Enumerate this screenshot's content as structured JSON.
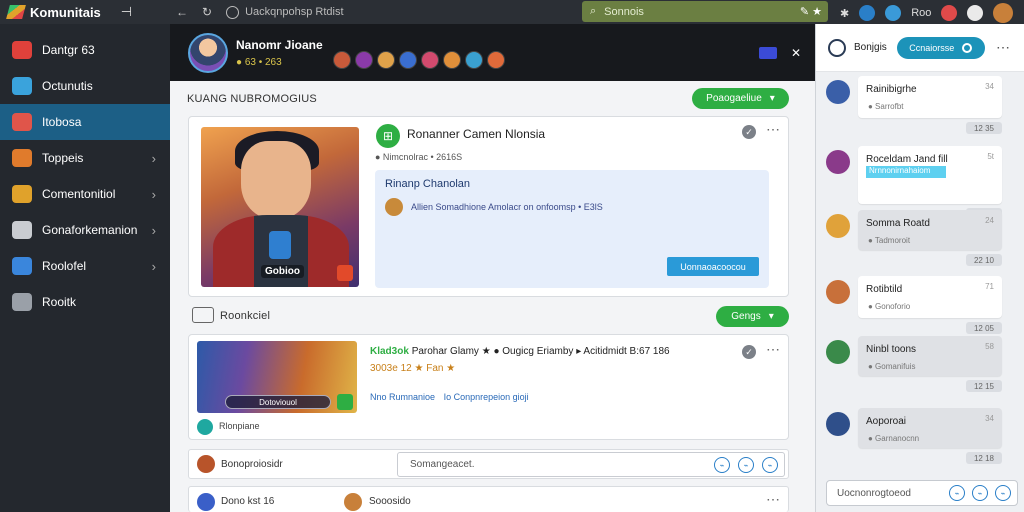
{
  "browser": {
    "app_title": "Komunitais",
    "pin_icon": "pin-icon",
    "url": "Uackqnpohsp Rtdist",
    "search_text": "Sonnois",
    "toolbar_text": "Roo"
  },
  "sidebar": {
    "items": [
      {
        "label": "Dantgr 63",
        "icon": "dashboard-icon",
        "color": "#e0413b",
        "chevron": false,
        "active": false
      },
      {
        "label": "Octunutis",
        "icon": "puzzle-icon",
        "color": "#3aa3dc",
        "chevron": false,
        "active": false
      },
      {
        "label": "Itobosa",
        "icon": "cube-icon",
        "color": "#e0554a",
        "chevron": false,
        "active": true
      },
      {
        "label": "Toppeis",
        "icon": "group-icon",
        "color": "#e07b2c",
        "chevron": true,
        "active": false
      },
      {
        "label": "Comentonitiol",
        "icon": "book-icon",
        "color": "#e0a22b",
        "chevron": true,
        "active": false
      },
      {
        "label": "Gonaforkemanion",
        "icon": "shield-icon",
        "color": "#c9ccd1",
        "chevron": true,
        "active": false
      },
      {
        "label": "Roolofel",
        "icon": "apps-icon",
        "color": "#3a86dc",
        "chevron": true,
        "active": false
      },
      {
        "label": "Rooitk",
        "icon": "calendar-icon",
        "color": "#9aa0a8",
        "chevron": false,
        "active": false
      }
    ]
  },
  "header": {
    "name": "Nanomr Jioane",
    "sub": "● 63 • 263",
    "member_colors": [
      "#c85a3a",
      "#8a3aa8",
      "#e0a24a",
      "#3a6ed0",
      "#d24a6e",
      "#e08f3a",
      "#3aa0d0",
      "#e06a3a"
    ]
  },
  "section1": {
    "title": "KUANG NUBROMOGIUS",
    "button": "Poaogaeliue"
  },
  "post1": {
    "character_tag": "Gobioo",
    "title": "Ronanner Camen Nlonsia",
    "meta": "● Nimcnolrac • 2616S",
    "info_title": "Rinanp Chanolan",
    "info_text": "Allien Somadhione Amolacr on onfoomsp • E3lS",
    "link_button": "Uonnaoacoocou",
    "icon_label": "✓"
  },
  "section2": {
    "title": "Roonkciel",
    "button": "Gengs"
  },
  "post2": {
    "image_bar": "Dotoviouol",
    "headline_prefix": "Klad3ok",
    "headline": "Parohar Glamy ★ ● Ougicg Eriamby ▸ Acitidmidt B:67 186",
    "subline": "3003e 12 ★ Fan ★",
    "tag1": "Nno Rumnanioe",
    "tag2": "Io Conpnrepeion gioji",
    "footer": "Rlonpiane"
  },
  "comment_row": {
    "author": "Bonoproiosidr",
    "placeholder": "Somangeacet."
  },
  "bottom_row": {
    "author": "Dono kst 16",
    "second": "Sooosido"
  },
  "chat": {
    "title": "Bonjgis",
    "pill": "Ccnaiorsse",
    "messages": [
      {
        "name": "Rainibigrhe",
        "meta": "● Sarrofbt",
        "time": "34",
        "stamp": "12 35",
        "grey": false,
        "avatar": "#3a5fa8",
        "highlight": ""
      },
      {
        "name": "Roceldam Jand fill",
        "meta": "",
        "time": "5t",
        "stamp": "12 35",
        "grey": false,
        "avatar": "#8a3a8a",
        "highlight": "Nrnnonirnahaiom"
      },
      {
        "name": "Somma Roatd",
        "meta": "● Tadmoroit",
        "time": "24",
        "stamp": "22 10",
        "grey": true,
        "avatar": "#e0a23a",
        "highlight": ""
      },
      {
        "name": "Rotibtild",
        "meta": "● Gonoforio",
        "time": "71",
        "stamp": "12 05",
        "grey": false,
        "avatar": "#c8703a",
        "highlight": ""
      },
      {
        "name": "Ninbl toons",
        "meta": "● Gomanifuis",
        "time": "58",
        "stamp": "12 15",
        "grey": true,
        "avatar": "#3a8a4a",
        "highlight": ""
      },
      {
        "name": "Aoporoai",
        "meta": "● Garnanocnn",
        "time": "34",
        "stamp": "12 18",
        "grey": true,
        "avatar": "#2f4f8a",
        "highlight": ""
      }
    ],
    "input_placeholder": "Uocnonrogtoeod"
  }
}
